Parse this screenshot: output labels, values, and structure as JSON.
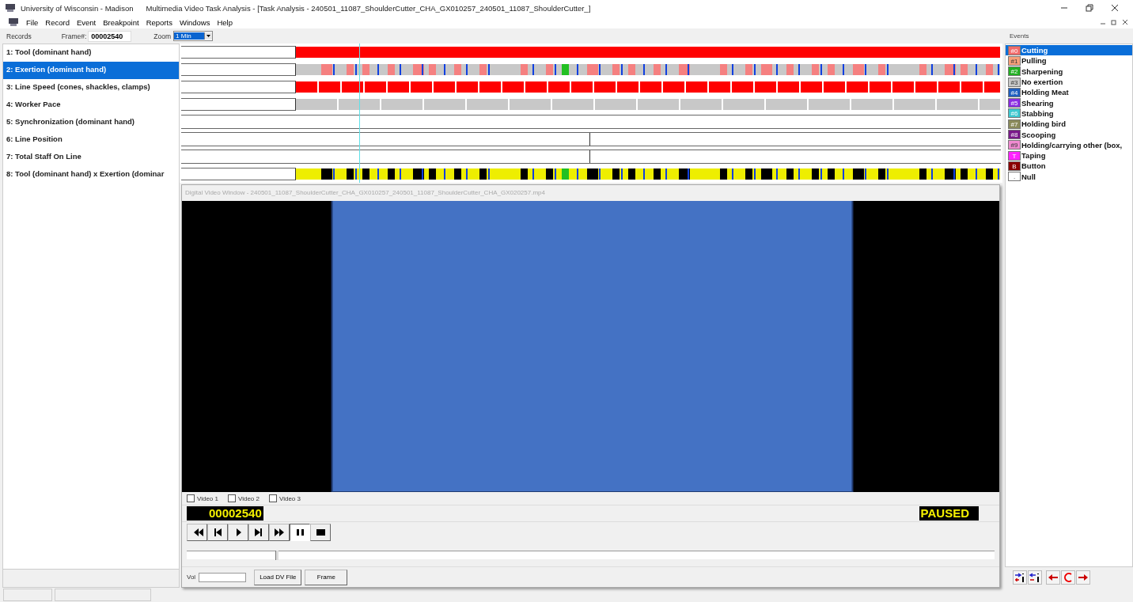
{
  "window": {
    "app_name": "University of Wisconsin - Madison",
    "title": "Multimedia Video Task Analysis - [Task Analysis - 240501_11087_ShoulderCutter_CHA_GX010257_240501_11087_ShoulderCutter_]"
  },
  "menu": [
    "File",
    "Record",
    "Event",
    "Breakpoint",
    "Reports",
    "Windows",
    "Help"
  ],
  "toolbar": {
    "records_label": "Records",
    "frame_label": "Frame#:",
    "frame_value": "00002540",
    "zoom_label": "Zoom",
    "zoom_value": "1 Min"
  },
  "tracks": [
    {
      "label": "1: Tool (dominant hand)",
      "selected": false,
      "kind": "solid"
    },
    {
      "label": "2: Exertion (dominant hand)",
      "selected": true,
      "kind": "exertion"
    },
    {
      "label": "3: Line Speed (cones, shackles, clamps)",
      "selected": false,
      "kind": "blocks"
    },
    {
      "label": "4: Worker Pace",
      "selected": false,
      "kind": "pace"
    },
    {
      "label": "5: Synchronization (dominant hand)",
      "selected": false,
      "kind": "empty"
    },
    {
      "label": "6: Line Position",
      "selected": false,
      "kind": "marker"
    },
    {
      "label": "7: Total Staff On Line",
      "selected": false,
      "kind": "marker"
    },
    {
      "label": "8: Tool (dominant hand) x Exertion (dominar",
      "selected": false,
      "kind": "combined"
    }
  ],
  "events": {
    "title": "Events",
    "items": [
      {
        "code": "#0",
        "label": "Cutting",
        "color": "#f26b6b",
        "selected": true
      },
      {
        "code": "#1",
        "label": "Pulling",
        "color": "#f7a07a",
        "selected": false
      },
      {
        "code": "#2",
        "label": "Sharpening",
        "color": "#22b022",
        "selected": false
      },
      {
        "code": "#3",
        "label": "No exertion",
        "color": "#c8c8c8",
        "selected": false
      },
      {
        "code": "#4",
        "label": "Holding Meat",
        "color": "#1f5fc0",
        "selected": false
      },
      {
        "code": "#5",
        "label": "Shearing",
        "color": "#8a2be2",
        "selected": false
      },
      {
        "code": "#6",
        "label": "Stabbing",
        "color": "#3ec8d0",
        "selected": false
      },
      {
        "code": "#7",
        "label": "Holding bird",
        "color": "#8a8a5a",
        "selected": false
      },
      {
        "code": "#8",
        "label": "Scooping",
        "color": "#7a1a8a",
        "selected": false
      },
      {
        "code": "#9",
        "label": "Holding/carrying other (box,",
        "color": "#f08ad0",
        "selected": false
      },
      {
        "code": "T",
        "label": "Taping",
        "color": "#ff22ff",
        "selected": false
      },
      {
        "code": "B",
        "label": "Button",
        "color": "#8b0000",
        "selected": false
      },
      {
        "code": ".",
        "label": "Null",
        "color": "#ffffff",
        "selected": false
      }
    ]
  },
  "video_window": {
    "title": "Digital Video Window - 240501_11087_ShoulderCutter_CHA_GX010257_240501_11087_ShoulderCutter_CHA_GX020257.mp4",
    "sources": [
      {
        "label": "Video 1",
        "checked": false
      },
      {
        "label": "Video 2",
        "checked": false
      },
      {
        "label": "Video 3",
        "checked": false
      }
    ],
    "frame_display": "00002540",
    "status": "PAUSED",
    "transport": [
      {
        "kind": "rewind",
        "selected": false
      },
      {
        "kind": "step-back",
        "selected": false
      },
      {
        "kind": "play",
        "selected": false
      },
      {
        "kind": "step-forward",
        "selected": false
      },
      {
        "kind": "fast-forward",
        "selected": false
      },
      {
        "kind": "pause",
        "selected": true
      },
      {
        "kind": "stop",
        "selected": false
      }
    ],
    "position": {
      "level": 0.11
    },
    "vol_label": "Vol",
    "buttons": [
      "Load DV File",
      "Frame"
    ]
  }
}
